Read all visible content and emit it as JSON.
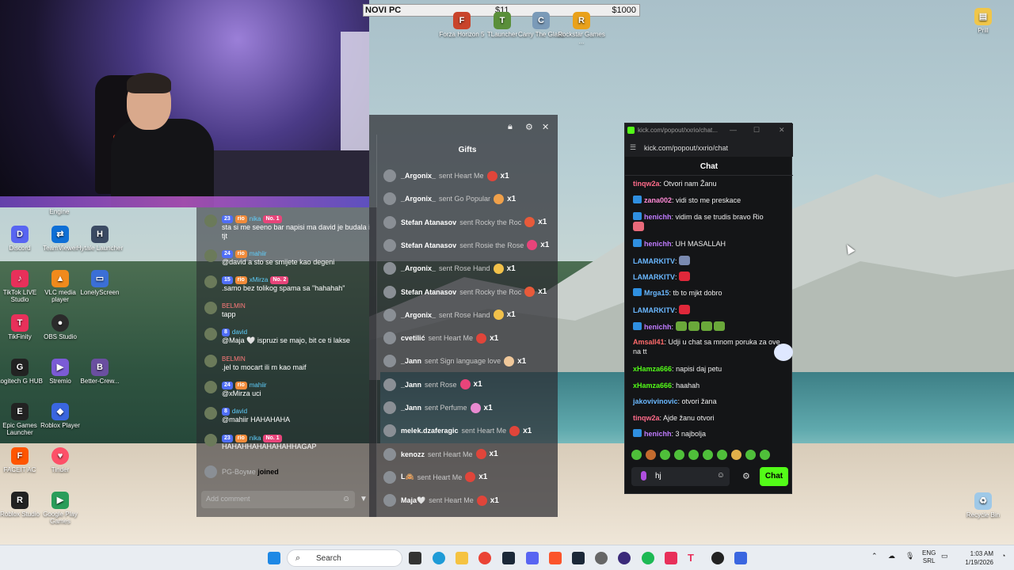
{
  "topbar": {
    "title": "NOVI PC",
    "current": "$11",
    "goal": "$1000"
  },
  "top_icons": [
    {
      "label": "Forza Horizon 5"
    },
    {
      "label": "TLauncher"
    },
    {
      "label": "Carry The Glass"
    },
    {
      "label": "Rockstar Games ..."
    },
    {
      "label": "Prill"
    }
  ],
  "left_icons": [
    {
      "label": "Engine"
    },
    {
      "label": "Discord"
    },
    {
      "label": "TeamViewer"
    },
    {
      "label": "Hytale Launcher"
    },
    {
      "label": "TikTok LIVE Studio"
    },
    {
      "label": "VLC media player"
    },
    {
      "label": "LonelyScreen"
    },
    {
      "label": "TikFinity"
    },
    {
      "label": "OBS Studio"
    },
    {
      "label": "Logitech G HUB"
    },
    {
      "label": "Stremio"
    },
    {
      "label": "Better-Crew..."
    },
    {
      "label": "Epic Games Launcher"
    },
    {
      "label": "Roblox Player"
    },
    {
      "label": "FACEIT AC"
    },
    {
      "label": "Tinder"
    },
    {
      "label": "Roblox Studio"
    },
    {
      "label": "Google Play Games"
    }
  ],
  "recycle_bin": "Recycle Bin",
  "tiktok_chat": {
    "messages": [
      {
        "lvl": "23",
        "fan": "rio",
        "user": "nika",
        "rank": "No. 1",
        "text": "sta si me seeno bar napisi ma david je budala i tjt"
      },
      {
        "lvl": "24",
        "fan": "rio",
        "user": "mahiir",
        "rank": "",
        "text": "@david a sto se smijete kao degeni"
      },
      {
        "lvl": "15",
        "fan": "rio",
        "user": "xMirza",
        "rank": "No. 2",
        "text": ".samo bez tolikog spama sa \"hahahah\""
      },
      {
        "lvl": "",
        "fan": "",
        "user": "BELMIN",
        "rank": "",
        "text": "tapp"
      },
      {
        "lvl": "8",
        "fan": "",
        "user": "david",
        "rank": "",
        "text": "@Maja 🤍 ispruzi se majo, bit ce ti lakse"
      },
      {
        "lvl": "",
        "fan": "",
        "user": "BELMIN",
        "rank": "",
        "text": ".jel to mocart ili m kao maif"
      },
      {
        "lvl": "24",
        "fan": "rio",
        "user": "mahiir",
        "rank": "",
        "text": "@xMirza uci"
      },
      {
        "lvl": "8",
        "fan": "",
        "user": "david",
        "rank": "",
        "text": "@mahiir HAHAHAHA"
      },
      {
        "lvl": "23",
        "fan": "rio",
        "user": "nika",
        "rank": "No. 1",
        "text": "HAHAHHAHAHAHAHHAGAP"
      }
    ],
    "joined_user": "PG-Boyме",
    "joined_text": "joined",
    "add_placeholder": "Add comment"
  },
  "gifts": {
    "title": "Gifts",
    "rows": [
      {
        "user": "_Argonix_",
        "action": "sent Heart Me",
        "count": "x1"
      },
      {
        "user": "_Argonix_",
        "action": "sent Go Popular",
        "count": "x1"
      },
      {
        "user": "Stefan Atanasov",
        "action": "sent Rocky the Roc",
        "count": "x1"
      },
      {
        "user": "Stefan Atanasov",
        "action": "sent Rosie the Rose",
        "count": "x1"
      },
      {
        "user": "_Argonix_",
        "action": "sent Rose Hand",
        "count": "x1"
      },
      {
        "user": "Stefan Atanasov",
        "action": "sent Rocky the Roc",
        "count": "x1"
      },
      {
        "user": "_Argonix_",
        "action": "sent Rose Hand",
        "count": "x1"
      },
      {
        "user": "cvetilić",
        "action": "sent Heart Me",
        "count": "x1"
      },
      {
        "user": "_Jann",
        "action": "sent Sign language love",
        "count": "x1"
      },
      {
        "user": "_Jann",
        "action": "sent Rose",
        "count": "x1"
      },
      {
        "user": "_Jann",
        "action": "sent Perfume",
        "count": "x1"
      },
      {
        "user": "melek.dzaferagic",
        "action": "sent Heart Me",
        "count": "x1"
      },
      {
        "user": "kenozz",
        "action": "sent Heart Me",
        "count": "x1"
      },
      {
        "user": "L🙈",
        "action": "sent Heart Me",
        "count": "x1"
      },
      {
        "user": "Maja🤍",
        "action": "sent Heart Me",
        "count": "x1"
      }
    ]
  },
  "kick": {
    "window_title": "kick.com/popout/xxrio/chat...",
    "url": "kick.com/popout/xxrio/chat",
    "chat_title": "Chat",
    "messages": [
      {
        "user": "tinqw2a",
        "color": "#ff6b8a",
        "badge": false,
        "text": "Otvori nam Žanu"
      },
      {
        "user": "zana002",
        "color": "#ff8ad6",
        "badge": true,
        "text": "vidi sto me preskace"
      },
      {
        "user": "henichh",
        "color": "#c07bff",
        "badge": true,
        "text": "vidim da se trudis bravo Rio"
      },
      {
        "user": "henichh",
        "color": "#c07bff",
        "badge": true,
        "text": "UH MASALLAH"
      },
      {
        "user": "LAMARKITV",
        "color": "#6ab8ff",
        "badge": false,
        "text": ""
      },
      {
        "user": "LAMARKITV",
        "color": "#6ab8ff",
        "badge": false,
        "text": ""
      },
      {
        "user": "Mrga15",
        "color": "#6ab8ff",
        "badge": true,
        "text": "tb to mjkt dobro"
      },
      {
        "user": "LAMARKITV",
        "color": "#6ab8ff",
        "badge": false,
        "text": ""
      },
      {
        "user": "henichh",
        "color": "#c07bff",
        "badge": true,
        "text": ""
      },
      {
        "user": "Amsall41",
        "color": "#ff6b6b",
        "badge": false,
        "text": "Udji u chat sa mnom poruka za ove na tt"
      },
      {
        "user": "xHamza666",
        "color": "#53fc18",
        "badge": false,
        "text": "napisi daj petu"
      },
      {
        "user": "xHamza666",
        "color": "#53fc18",
        "badge": false,
        "text": "haahah"
      },
      {
        "user": "jakovivinovic",
        "color": "#6ab8ff",
        "badge": false,
        "text": "otvori žana"
      },
      {
        "user": "tinqw2a",
        "color": "#ff6b8a",
        "badge": false,
        "text": "Ajde žanu otvori"
      },
      {
        "user": "henichh",
        "color": "#c07bff",
        "badge": true,
        "text": "3 najbolja"
      }
    ],
    "input_value": "hj",
    "send_label": "Chat"
  },
  "taskbar": {
    "search_placeholder": "Search",
    "lang_top": "ENG",
    "lang_bottom": "SRL",
    "time": "1:03 AM",
    "date": "1/19/2026"
  }
}
